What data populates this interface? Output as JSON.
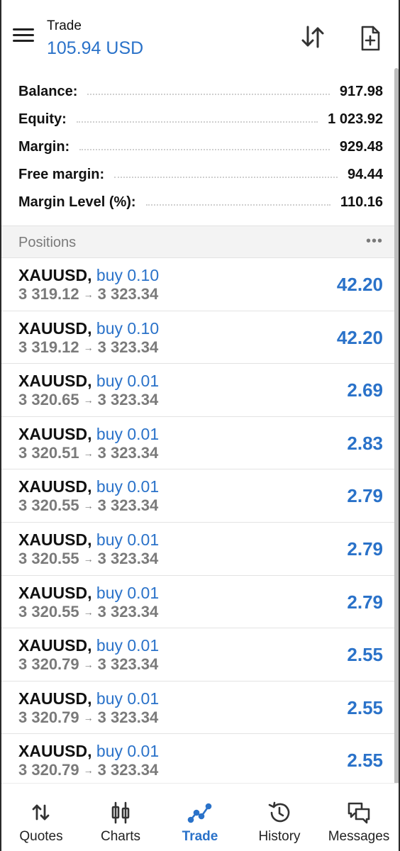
{
  "header": {
    "title": "Trade",
    "subtitle": "105.94 USD"
  },
  "summary": [
    {
      "label": "Balance:",
      "value": "917.98"
    },
    {
      "label": "Equity:",
      "value": "1 023.92"
    },
    {
      "label": "Margin:",
      "value": "929.48"
    },
    {
      "label": "Free margin:",
      "value": "94.44"
    },
    {
      "label": "Margin Level (%):",
      "value": "110.16"
    }
  ],
  "positions": {
    "label": "Positions",
    "more": "•••",
    "arrow": "→",
    "items": [
      {
        "symbol": "XAUUSD,",
        "direction": "buy 0.10",
        "open": "3 319.12",
        "current": "3 323.34",
        "profit": "42.20"
      },
      {
        "symbol": "XAUUSD,",
        "direction": "buy 0.10",
        "open": "3 319.12",
        "current": "3 323.34",
        "profit": "42.20"
      },
      {
        "symbol": "XAUUSD,",
        "direction": "buy 0.01",
        "open": "3 320.65",
        "current": "3 323.34",
        "profit": "2.69"
      },
      {
        "symbol": "XAUUSD,",
        "direction": "buy 0.01",
        "open": "3 320.51",
        "current": "3 323.34",
        "profit": "2.83"
      },
      {
        "symbol": "XAUUSD,",
        "direction": "buy 0.01",
        "open": "3 320.55",
        "current": "3 323.34",
        "profit": "2.79"
      },
      {
        "symbol": "XAUUSD,",
        "direction": "buy 0.01",
        "open": "3 320.55",
        "current": "3 323.34",
        "profit": "2.79"
      },
      {
        "symbol": "XAUUSD,",
        "direction": "buy 0.01",
        "open": "3 320.55",
        "current": "3 323.34",
        "profit": "2.79"
      },
      {
        "symbol": "XAUUSD,",
        "direction": "buy 0.01",
        "open": "3 320.79",
        "current": "3 323.34",
        "profit": "2.55"
      },
      {
        "symbol": "XAUUSD,",
        "direction": "buy 0.01",
        "open": "3 320.79",
        "current": "3 323.34",
        "profit": "2.55"
      },
      {
        "symbol": "XAUUSD,",
        "direction": "buy 0.01",
        "open": "3 320.79",
        "current": "3 323.34",
        "profit": "2.55"
      }
    ]
  },
  "nav": {
    "items": [
      {
        "label": "Quotes",
        "icon": "quotes-icon"
      },
      {
        "label": "Charts",
        "icon": "charts-icon"
      },
      {
        "label": "Trade",
        "icon": "trade-icon",
        "active": true
      },
      {
        "label": "History",
        "icon": "history-icon"
      },
      {
        "label": "Messages",
        "icon": "messages-icon"
      }
    ]
  },
  "colors": {
    "accent": "#2a72c9",
    "muted": "#7a7a7a",
    "text": "#111111"
  }
}
